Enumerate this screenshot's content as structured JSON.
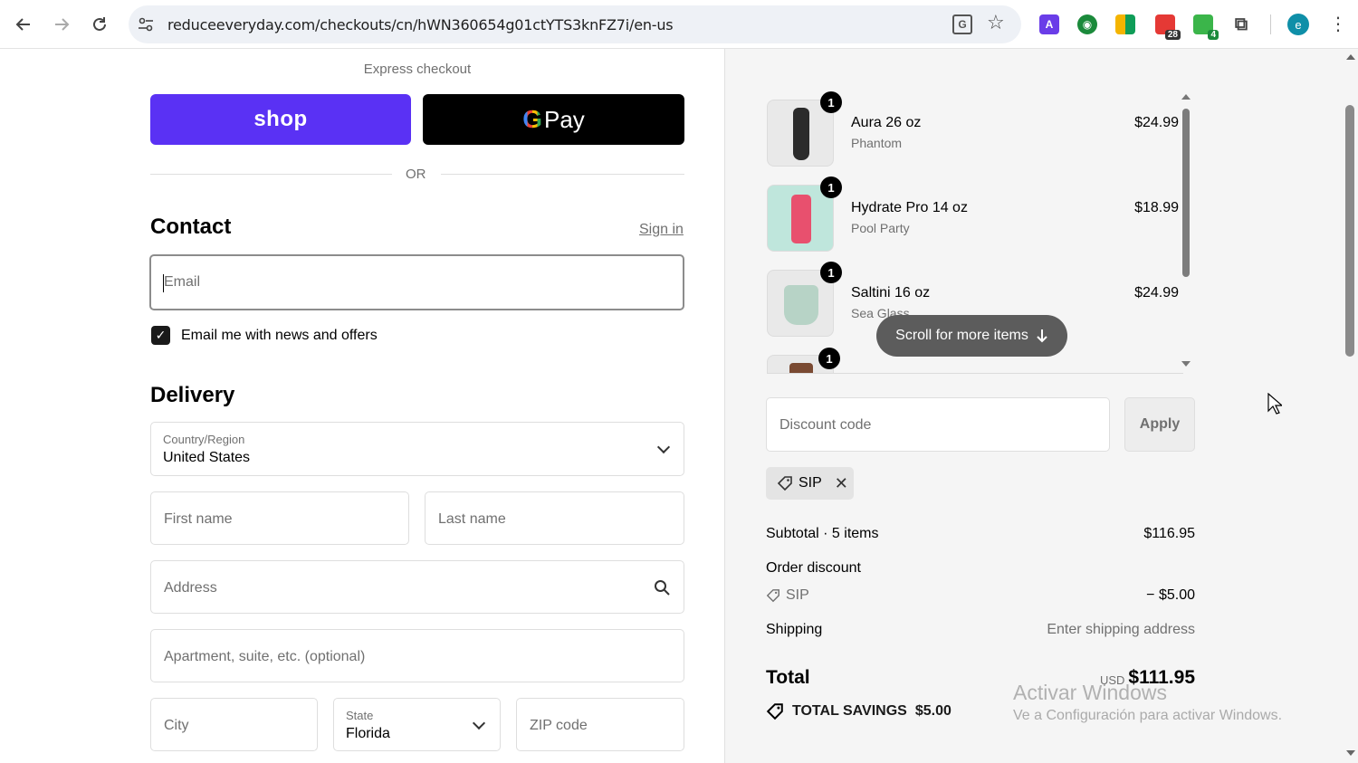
{
  "browser": {
    "url": "reduceeveryday.com/checkouts/cn/hWN360654g01ctYTS3knFZ7i/en-us",
    "ext_badges": [
      "28",
      "4"
    ],
    "profile_initial": "e"
  },
  "checkout": {
    "express_label": "Express checkout",
    "shop_label": "shop",
    "gpay_label": "Pay",
    "or_label": "OR",
    "contact_title": "Contact",
    "signin_label": "Sign in",
    "email_placeholder": "Email",
    "newsletter_label": "Email me with news and offers",
    "newsletter_checked": true,
    "delivery_title": "Delivery",
    "country_label": "Country/Region",
    "country_value": "United States",
    "first_name_placeholder": "First name",
    "last_name_placeholder": "Last name",
    "address_placeholder": "Address",
    "apartment_placeholder": "Apartment, suite, etc. (optional)",
    "city_placeholder": "City",
    "state_label": "State",
    "state_value": "Florida",
    "zip_placeholder": "ZIP code"
  },
  "cart": {
    "items": [
      {
        "qty": "1",
        "name": "Aura 26 oz",
        "variant": "Phantom",
        "price": "$24.99"
      },
      {
        "qty": "1",
        "name": "Hydrate Pro 14 oz",
        "variant": "Pool Party",
        "price": "$18.99"
      },
      {
        "qty": "1",
        "name": "Saltini 16 oz",
        "variant": "Sea Glass",
        "price": "$24.99"
      },
      {
        "qty": "1"
      }
    ],
    "scroll_hint": "Scroll for more items",
    "discount_placeholder": "Discount code",
    "apply_label": "Apply",
    "applied_code": "SIP",
    "subtotal_label": "Subtotal · 5 items",
    "subtotal_value": "$116.95",
    "order_discount_label": "Order discount",
    "discount_code": "SIP",
    "discount_value": "− $5.00",
    "shipping_label": "Shipping",
    "shipping_value": "Enter shipping address",
    "total_label": "Total",
    "total_currency": "USD",
    "total_value": "$111.95",
    "savings_label": "TOTAL SAVINGS",
    "savings_value": "$5.00"
  },
  "watermark": {
    "line1": "Activar Windows",
    "line2": "Ve a Configuración para activar Windows."
  },
  "colors": {
    "shop_purple": "#5a31f4",
    "gpay_black": "#000000",
    "summary_bg": "#f5f5f5"
  }
}
